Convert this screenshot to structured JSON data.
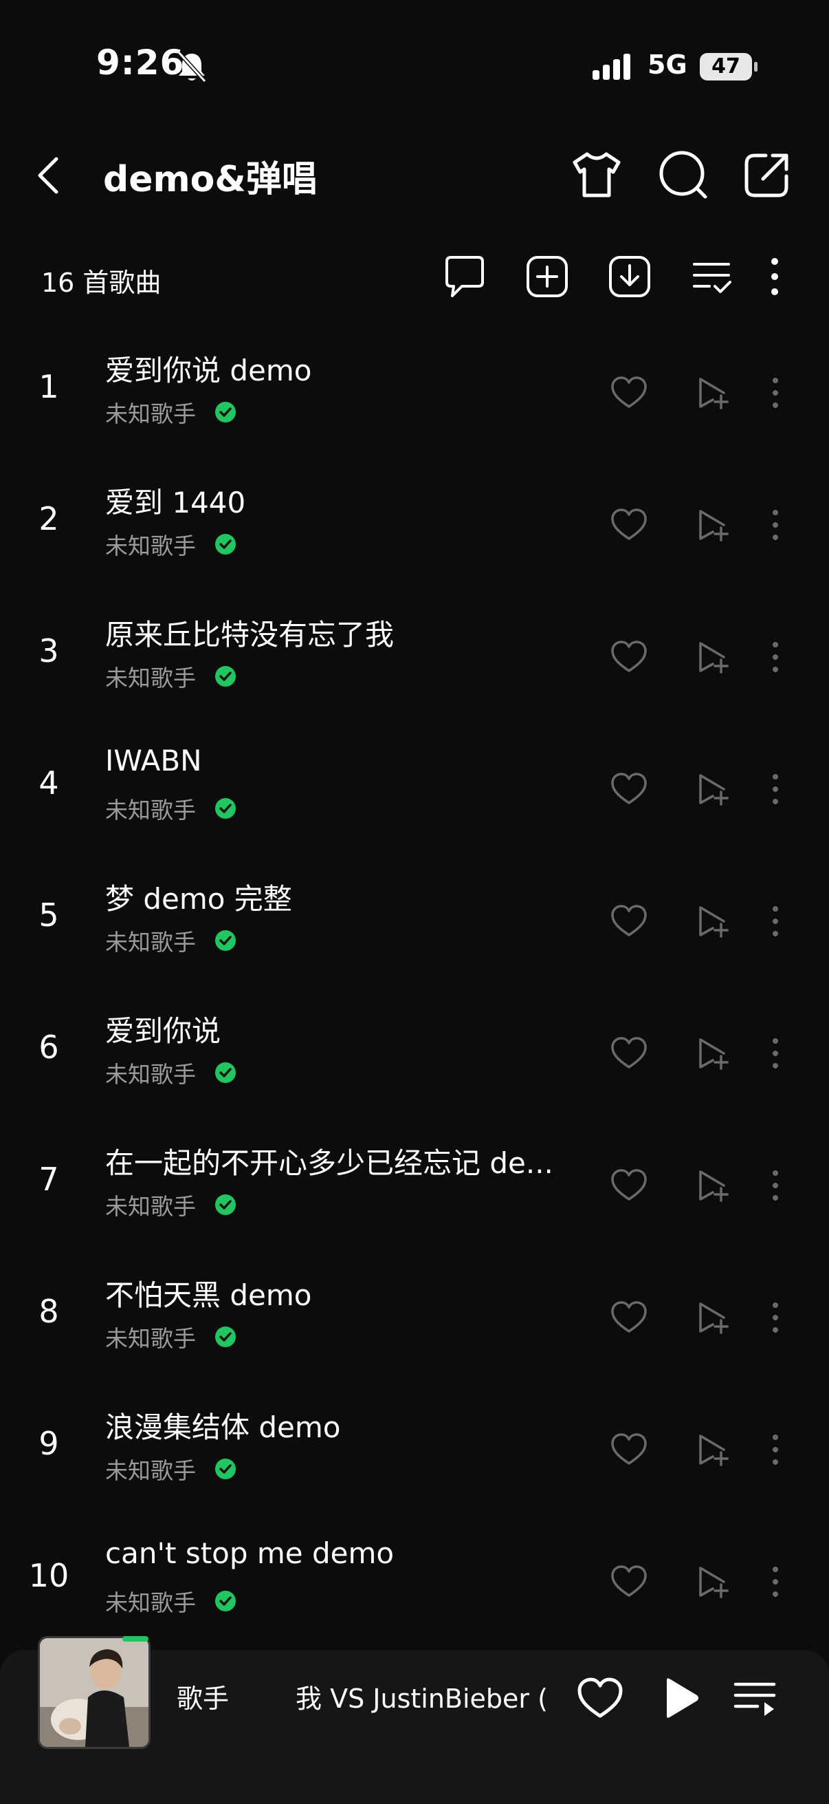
{
  "status": {
    "time": "9:26",
    "network": "5G",
    "battery": "47"
  },
  "header": {
    "title": "demo&弹唱"
  },
  "toolbar": {
    "count_label": "16 首歌曲"
  },
  "songs": [
    {
      "index": "1",
      "title": "爱到你说 demo",
      "artist": "未知歌手"
    },
    {
      "index": "2",
      "title": "爱到 1440",
      "artist": "未知歌手"
    },
    {
      "index": "3",
      "title": "原来丘比特没有忘了我",
      "artist": "未知歌手"
    },
    {
      "index": "4",
      "title": "IWABN",
      "artist": "未知歌手"
    },
    {
      "index": "5",
      "title": "梦 demo 完整",
      "artist": "未知歌手"
    },
    {
      "index": "6",
      "title": "爱到你说",
      "artist": "未知歌手"
    },
    {
      "index": "7",
      "title": "在一起的不开心多少已经忘记 de...",
      "artist": "未知歌手"
    },
    {
      "index": "8",
      "title": "不怕天黑 demo",
      "artist": "未知歌手"
    },
    {
      "index": "9",
      "title": "浪漫集结体 demo",
      "artist": "未知歌手"
    },
    {
      "index": "10",
      "title": "can't stop me demo",
      "artist": "未知歌手"
    }
  ],
  "player": {
    "title": "歌手",
    "scroll_text": "我 VS JustinBieber ("
  },
  "colors": {
    "background": "#0c0c0c",
    "verified": "#1ec760",
    "muted_text": "#9a9a9a",
    "player_bg": "#161616"
  }
}
